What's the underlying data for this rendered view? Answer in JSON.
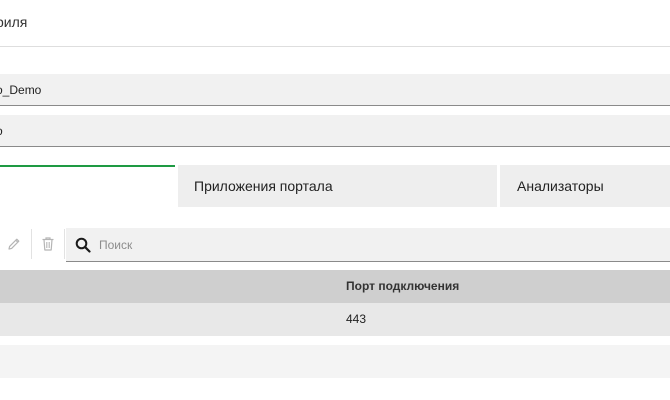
{
  "header": {
    "title": "риля"
  },
  "form": {
    "field1_value": "o_Demo",
    "field2_value": "o"
  },
  "tabs": [
    {
      "label": ""
    },
    {
      "label": "Приложения портала"
    },
    {
      "label": "Анализаторы"
    }
  ],
  "toolbar": {
    "icons": [
      "pencil-icon",
      "trash-icon",
      "search-icon"
    ],
    "search_placeholder": "Поиск",
    "colors": {
      "active_tab_accent": "#1e9a43"
    }
  },
  "table": {
    "columns": [
      "Порт подключения"
    ],
    "rows": [
      {
        "port": "443"
      }
    ]
  }
}
